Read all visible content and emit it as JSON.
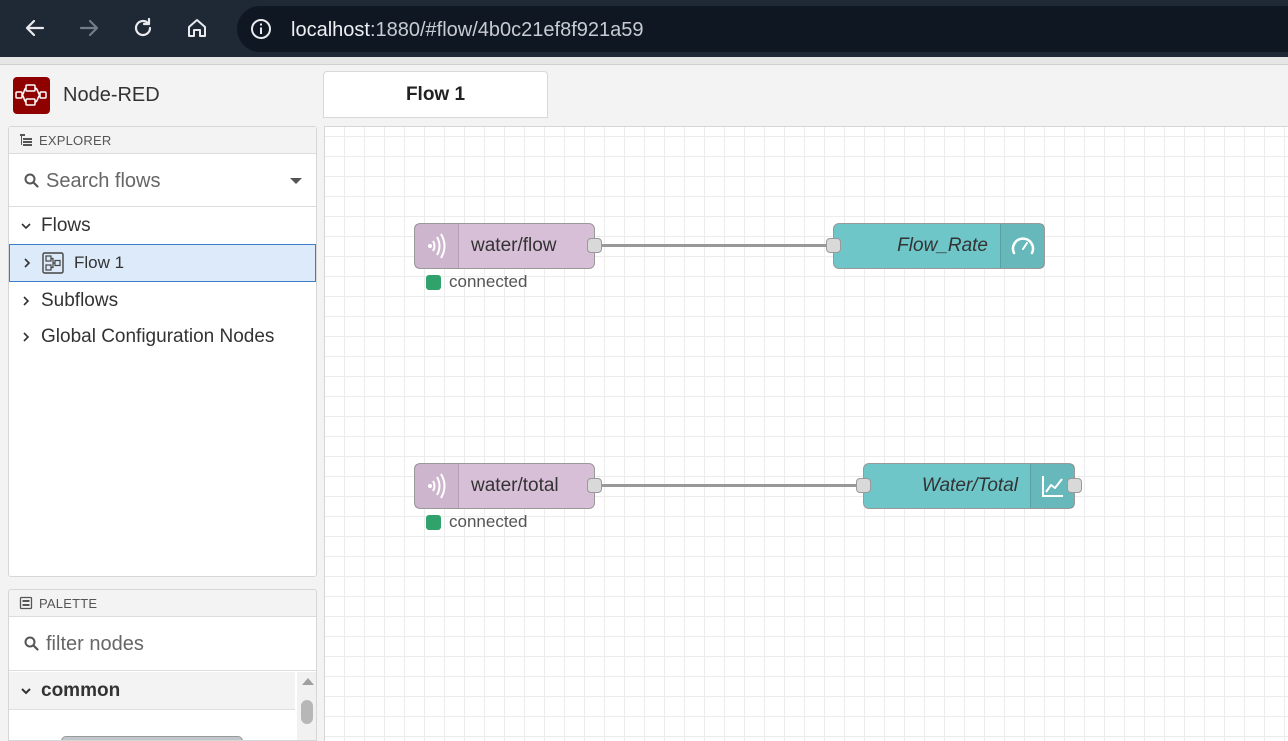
{
  "browser": {
    "url_host": "localhost",
    "url_path": ":1880/#flow/4b0c21ef8f921a59"
  },
  "app": {
    "title": "Node-RED"
  },
  "workspace_tabs": [
    {
      "label": "Flow 1"
    }
  ],
  "explorer": {
    "header": "EXPLORER",
    "search_placeholder": "Search flows",
    "tree": {
      "flows": "Flows",
      "flow1": "Flow 1",
      "subflows": "Subflows",
      "global_config": "Global Configuration Nodes"
    }
  },
  "palette": {
    "header": "PALETTE",
    "filter_placeholder": "filter nodes",
    "category": "common"
  },
  "flow": {
    "nodes": {
      "mqtt_flow": {
        "label": "water/flow",
        "status": "connected"
      },
      "gauge": {
        "label": "Flow_Rate"
      },
      "mqtt_total": {
        "label": "water/total",
        "status": "connected"
      },
      "chart": {
        "label": "Water/Total"
      }
    }
  },
  "colors": {
    "mqtt_node": "#d8bfd8",
    "dashboard_node": "#6fc6c9",
    "status_connected": "#2fa36b",
    "logo": "#8f0000",
    "selection": "#3c7fc9"
  },
  "icons": {
    "back": "arrow-left-icon",
    "forward": "arrow-right-icon",
    "reload": "reload-icon",
    "home": "home-icon",
    "site_info": "info-icon",
    "mqtt": "wifi-signal-icon",
    "gauge": "gauge-icon",
    "chart": "line-chart-icon"
  }
}
